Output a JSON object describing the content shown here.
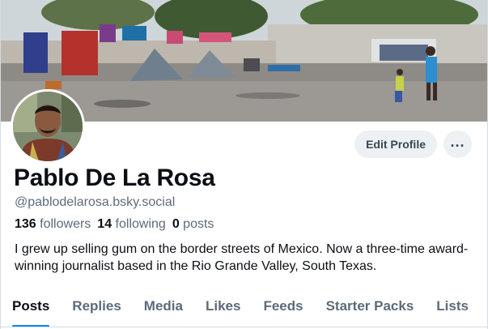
{
  "profile": {
    "display_name": "Pablo De La Rosa",
    "handle": "@pablodelarosa.bsky.social",
    "bio": "I grew up selling gum on the border streets of Mexico. Now a three-time award-winning journalist based in the Rio Grande Valley, South Texas.",
    "stats": {
      "followers_count": "136",
      "followers_label": "followers",
      "following_count": "14",
      "following_label": "following",
      "posts_count": "0",
      "posts_label": "posts"
    }
  },
  "actions": {
    "edit_label": "Edit Profile",
    "more_label": "..."
  },
  "tabs": [
    {
      "label": "Posts",
      "active": true
    },
    {
      "label": "Replies",
      "active": false
    },
    {
      "label": "Media",
      "active": false
    },
    {
      "label": "Likes",
      "active": false
    },
    {
      "label": "Feeds",
      "active": false
    },
    {
      "label": "Starter Packs",
      "active": false
    },
    {
      "label": "Lists",
      "active": false
    }
  ],
  "colors": {
    "accent": "#1083fe",
    "text": "#0b0f14",
    "muted": "#5d6b79",
    "button_bg": "#eef1f4"
  },
  "icons": {
    "more": "ellipsis-icon"
  }
}
